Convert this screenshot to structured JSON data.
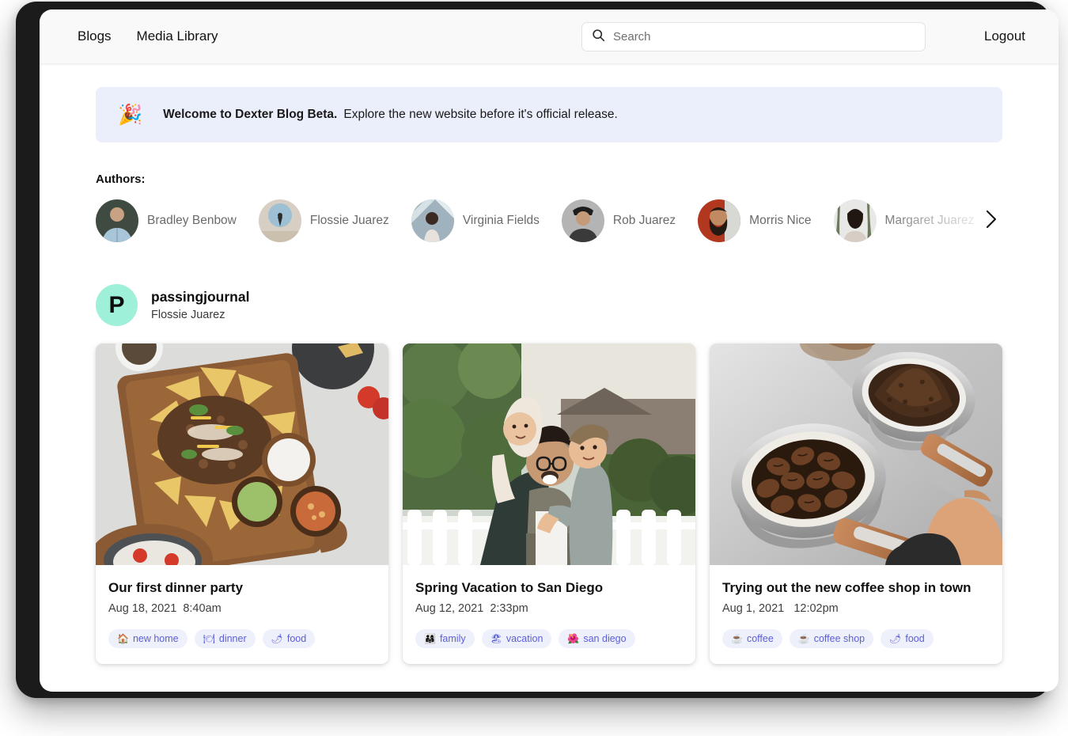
{
  "header": {
    "nav": [
      {
        "label": "Blogs"
      },
      {
        "label": "Media Library"
      }
    ],
    "search": {
      "value": "",
      "placeholder": "Search"
    },
    "logout_label": "Logout"
  },
  "banner": {
    "emoji": "🎉",
    "title": "Welcome to Dexter Blog Beta.",
    "message": "Explore the new website before it's official release."
  },
  "authors": {
    "label": "Authors:",
    "items": [
      {
        "name": "Bradley Benbow"
      },
      {
        "name": "Flossie Juarez"
      },
      {
        "name": "Virginia Fields"
      },
      {
        "name": "Rob Juarez"
      },
      {
        "name": "Morris Nice"
      },
      {
        "name": "Margaret Juarez"
      },
      {
        "name": ""
      }
    ],
    "next_icon": "chevron-right-icon"
  },
  "blog": {
    "avatar_letter": "P",
    "avatar_color": "#9ff0d8",
    "title": "passingjournal",
    "author": "Flossie Juarez"
  },
  "posts": [
    {
      "title": "Our first dinner party",
      "date": "Aug 18, 2021",
      "time": "8:40am",
      "image_alt": "nachos-platter-photo",
      "tags": [
        {
          "emoji": "🏠",
          "label": "new home"
        },
        {
          "emoji": "🍽",
          "label": "dinner"
        },
        {
          "emoji": "🌶",
          "label": "food"
        }
      ]
    },
    {
      "title": "Spring Vacation to San Diego",
      "date": "Aug 12, 2021",
      "time": "2:33pm",
      "image_alt": "family-father-with-children-photo",
      "tags": [
        {
          "emoji": "👨‍👩‍👧",
          "label": "family"
        },
        {
          "emoji": "🏖",
          "label": "vacation"
        },
        {
          "emoji": "🌺",
          "label": "san diego"
        }
      ]
    },
    {
      "title": "Trying out the new coffee shop in town",
      "date": "Aug 1, 2021",
      "time": "12:02pm",
      "image_alt": "coffee-portafilters-beans-photo",
      "tags": [
        {
          "emoji": "☕",
          "label": "coffee"
        },
        {
          "emoji": "☕",
          "label": "coffee shop"
        },
        {
          "emoji": "🌶",
          "label": "food"
        }
      ]
    }
  ],
  "theme": {
    "banner_bg": "#ebeefb",
    "tag_bg": "#eef0fc",
    "tag_text": "#5b5fd6",
    "topbar_bg": "#f9f9f9"
  }
}
